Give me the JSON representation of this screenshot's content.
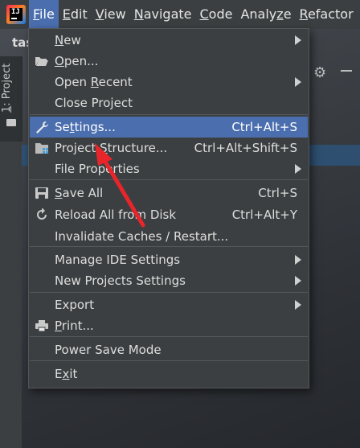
{
  "menubar": {
    "items": [
      {
        "label": "File",
        "mnemonic": "F"
      },
      {
        "label": "Edit",
        "mnemonic": "E"
      },
      {
        "label": "View",
        "mnemonic": "V"
      },
      {
        "label": "Navigate",
        "mnemonic": "N"
      },
      {
        "label": "Code",
        "mnemonic": "C"
      },
      {
        "label": "Analyze",
        "mnemonic": "z"
      },
      {
        "label": "Refactor",
        "mnemonic": "R"
      }
    ]
  },
  "background": {
    "title_fragment": "tas",
    "side_tab_label": "1: Project",
    "side_tab_mnemonic": "1"
  },
  "file_menu": {
    "groups": [
      [
        {
          "label": "New",
          "mnemonic": "N",
          "submenu": true
        },
        {
          "label": "Open...",
          "mnemonic": "O",
          "icon": "folder-open-icon"
        },
        {
          "label": "Open Recent",
          "mnemonic": "R",
          "submenu": true
        },
        {
          "label": "Close Project"
        }
      ],
      [
        {
          "label": "Settings...",
          "mnemonic": "t",
          "shortcut": "Ctrl+Alt+S",
          "icon": "wrench-icon",
          "highlighted": true
        },
        {
          "label": "Project Structure...",
          "mnemonic": "S",
          "shortcut": "Ctrl+Alt+Shift+S",
          "icon": "project-structure-icon"
        },
        {
          "label": "File Properties",
          "submenu": true
        }
      ],
      [
        {
          "label": "Save All",
          "mnemonic": "S",
          "shortcut": "Ctrl+S",
          "icon": "save-icon"
        },
        {
          "label": "Reload All from Disk",
          "shortcut": "Ctrl+Alt+Y",
          "icon": "reload-icon"
        },
        {
          "label": "Invalidate Caches / Restart..."
        }
      ],
      [
        {
          "label": "Manage IDE Settings",
          "submenu": true
        },
        {
          "label": "New Projects Settings",
          "submenu": true
        }
      ],
      [
        {
          "label": "Export",
          "submenu": true
        },
        {
          "label": "Print...",
          "mnemonic": "P",
          "icon": "print-icon"
        }
      ],
      [
        {
          "label": "Power Save Mode"
        }
      ],
      [
        {
          "label": "Exit",
          "mnemonic": "x"
        }
      ]
    ]
  },
  "colors": {
    "menubar_bg": "#3c3f41",
    "menu_bg": "#3c3f41",
    "highlight": "#4b6eaf",
    "annotation_arrow": "#e8252b"
  }
}
